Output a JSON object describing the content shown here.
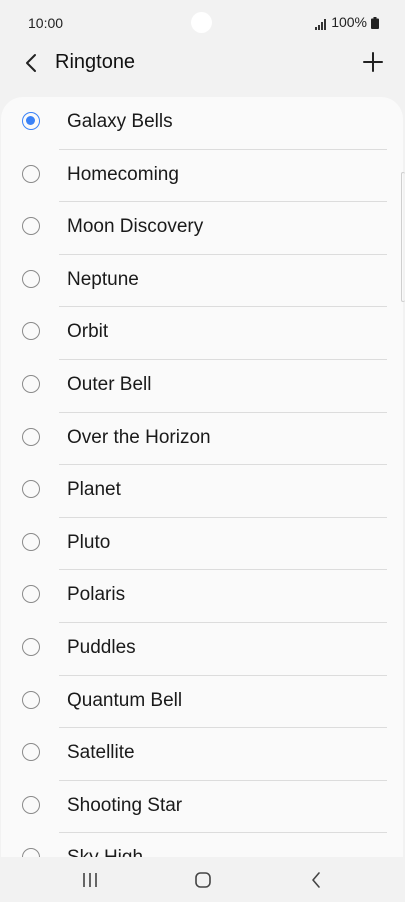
{
  "status_bar": {
    "time": "10:00",
    "battery_text": "100%",
    "icons": [
      "signal-icon",
      "battery-icon"
    ]
  },
  "app_bar": {
    "title": "Ringtone",
    "back_icon": "chevron-left-icon",
    "add_icon": "plus-icon"
  },
  "ringtones": [
    {
      "label": "Galaxy Bells",
      "selected": true
    },
    {
      "label": "Homecoming",
      "selected": false
    },
    {
      "label": "Moon Discovery",
      "selected": false
    },
    {
      "label": "Neptune",
      "selected": false
    },
    {
      "label": "Orbit",
      "selected": false
    },
    {
      "label": "Outer Bell",
      "selected": false
    },
    {
      "label": "Over the Horizon",
      "selected": false
    },
    {
      "label": "Planet",
      "selected": false
    },
    {
      "label": "Pluto",
      "selected": false
    },
    {
      "label": "Polaris",
      "selected": false
    },
    {
      "label": "Puddles",
      "selected": false
    },
    {
      "label": "Quantum Bell",
      "selected": false
    },
    {
      "label": "Satellite",
      "selected": false
    },
    {
      "label": "Shooting Star",
      "selected": false
    },
    {
      "label": "Sky High",
      "selected": false
    }
  ],
  "nav_bar": {
    "icons": [
      "recents-icon",
      "home-icon",
      "back-icon"
    ]
  },
  "colors": {
    "accent": "#3a82f7",
    "background": "#f2f2f2",
    "card": "#fafafa"
  }
}
